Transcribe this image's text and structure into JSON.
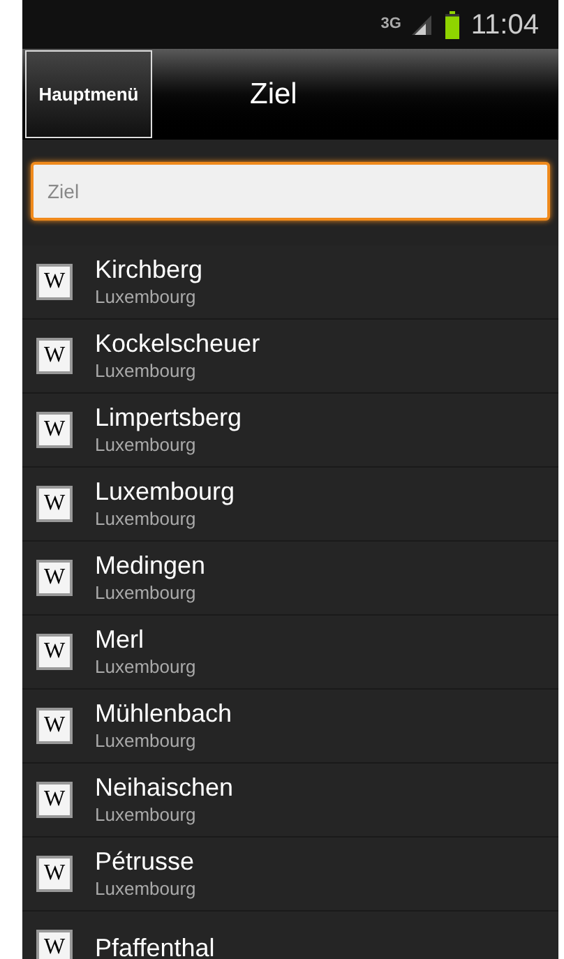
{
  "status_bar": {
    "network": "3G",
    "time": "11:04"
  },
  "header": {
    "menu_button": "Hauptmenü",
    "title": "Ziel"
  },
  "search": {
    "placeholder": "Ziel",
    "focused": true
  },
  "results": [
    {
      "icon": "W",
      "name": "Kirchberg",
      "country": "Luxembourg"
    },
    {
      "icon": "W",
      "name": "Kockelscheuer",
      "country": "Luxembourg"
    },
    {
      "icon": "W",
      "name": "Limpertsberg",
      "country": "Luxembourg"
    },
    {
      "icon": "W",
      "name": "Luxembourg",
      "country": "Luxembourg"
    },
    {
      "icon": "W",
      "name": "Medingen",
      "country": "Luxembourg"
    },
    {
      "icon": "W",
      "name": "Merl",
      "country": "Luxembourg"
    },
    {
      "icon": "W",
      "name": "Mühlenbach",
      "country": "Luxembourg"
    },
    {
      "icon": "W",
      "name": "Neihaischen",
      "country": "Luxembourg"
    },
    {
      "icon": "W",
      "name": "Pétrusse",
      "country": "Luxembourg"
    },
    {
      "icon": "W",
      "name": "Pfaffenthal"
    }
  ]
}
